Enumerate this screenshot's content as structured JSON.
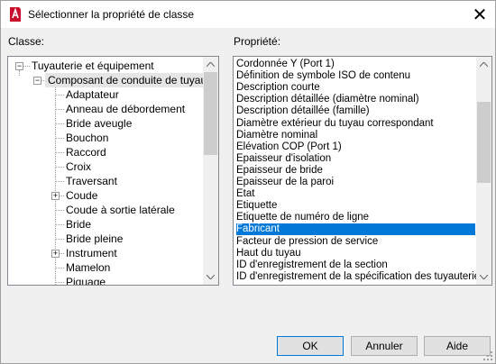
{
  "window": {
    "title": "Sélectionner la propriété de classe",
    "close_glyph": "✕",
    "icon": "autocad-app-icon"
  },
  "classe": {
    "label": "Classe:",
    "tree": [
      {
        "label": "Tuyauterie et équipement",
        "level": 0,
        "expander": "−"
      },
      {
        "label": "Composant de conduite de tuyau",
        "level": 1,
        "expander": "−"
      },
      {
        "label": "Adaptateur",
        "level": 2
      },
      {
        "label": "Anneau de débordement",
        "level": 2
      },
      {
        "label": "Bride aveugle",
        "level": 2
      },
      {
        "label": "Bouchon",
        "level": 2
      },
      {
        "label": "Raccord",
        "level": 2
      },
      {
        "label": "Croix",
        "level": 2
      },
      {
        "label": "Traversant",
        "level": 2
      },
      {
        "label": "Coude",
        "level": 2,
        "expander": "+"
      },
      {
        "label": "Coude à sortie latérale",
        "level": 2
      },
      {
        "label": "Bride",
        "level": 2
      },
      {
        "label": "Bride pleine",
        "level": 2
      },
      {
        "label": "Instrument",
        "level": 2,
        "expander": "+"
      },
      {
        "label": "Mamelon",
        "level": 2
      },
      {
        "label": "Piquage",
        "level": 2
      }
    ]
  },
  "propriete": {
    "label": "Propriété:",
    "selected_index": 14,
    "items": [
      "Cordonnée Y (Port 1)",
      "Définition de symbole ISO de contenu",
      "Description courte",
      "Description détaillée (diamètre nominal)",
      "Description détaillée (famille)",
      "Diamètre extérieur du tuyau correspondant",
      "Diamètre nominal",
      "Elévation COP (Port 1)",
      "Epaisseur d'isolation",
      "Epaisseur de bride",
      "Epaisseur de la paroi",
      "Etat",
      "Etiquette",
      "Etiquette de numéro de ligne",
      "Fabricant",
      "Facteur de pression de service",
      "Haut du tuyau",
      "ID d'enregistrement de la section",
      "ID d'enregistrement de la spécification des tuyauteries"
    ]
  },
  "buttons": {
    "ok": "OK",
    "cancel": "Annuler",
    "help": "Aide"
  },
  "colors": {
    "selection": "#0078d7",
    "icon_red": "#c8102e"
  }
}
